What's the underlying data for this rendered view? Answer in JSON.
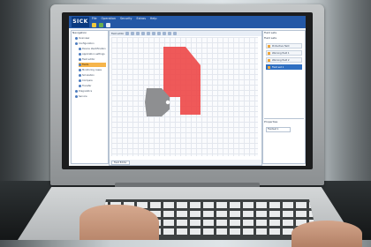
{
  "app": {
    "logo_text": "SICK",
    "menu": [
      "File",
      "Operation",
      "Security",
      "Extras",
      "Help"
    ],
    "toolbar_icons": [
      "new-icon",
      "open-icon",
      "save-icon"
    ]
  },
  "left_panel": {
    "title": "Navigation",
    "items": [
      {
        "label": "Overview",
        "sub": false,
        "selected": false
      },
      {
        "label": "Configuration",
        "sub": false,
        "selected": false
      },
      {
        "label": "Device identification",
        "sub": true,
        "selected": false
      },
      {
        "label": "Application settings",
        "sub": true,
        "selected": false
      },
      {
        "label": "Field editor",
        "sub": true,
        "selected": false
      },
      {
        "label": "Fields",
        "sub": true,
        "selected": true
      },
      {
        "label": "Monitoring cases",
        "sub": true,
        "selected": false
      },
      {
        "label": "Simulation",
        "sub": true,
        "selected": false
      },
      {
        "label": "Compare",
        "sub": true,
        "selected": false
      },
      {
        "label": "Transfer",
        "sub": true,
        "selected": false
      },
      {
        "label": "Diagnostics",
        "sub": false,
        "selected": false
      },
      {
        "label": "Service",
        "sub": false,
        "selected": false
      }
    ]
  },
  "editor": {
    "toolbar_label": "Field editor",
    "tab_label": "Field Editor",
    "tool_count_hint": "drawing tools",
    "protective_field_color": "#ee4b4b",
    "scanner_color": "#8e8f91"
  },
  "right_panel": {
    "title": "Field sets",
    "subtitle": "Field sets",
    "items": [
      {
        "label": "Protective field",
        "selected": false
      },
      {
        "label": "Warning field 1",
        "selected": false
      },
      {
        "label": "Warning field 2",
        "selected": false
      },
      {
        "label": "Field set 1",
        "selected": true
      }
    ],
    "props_title": "Properties",
    "field_label": "Fieldset 1"
  },
  "colors": {
    "titlebar": "#2458a6",
    "selection": "#f6b54b",
    "accent": "#2f6fc2"
  }
}
